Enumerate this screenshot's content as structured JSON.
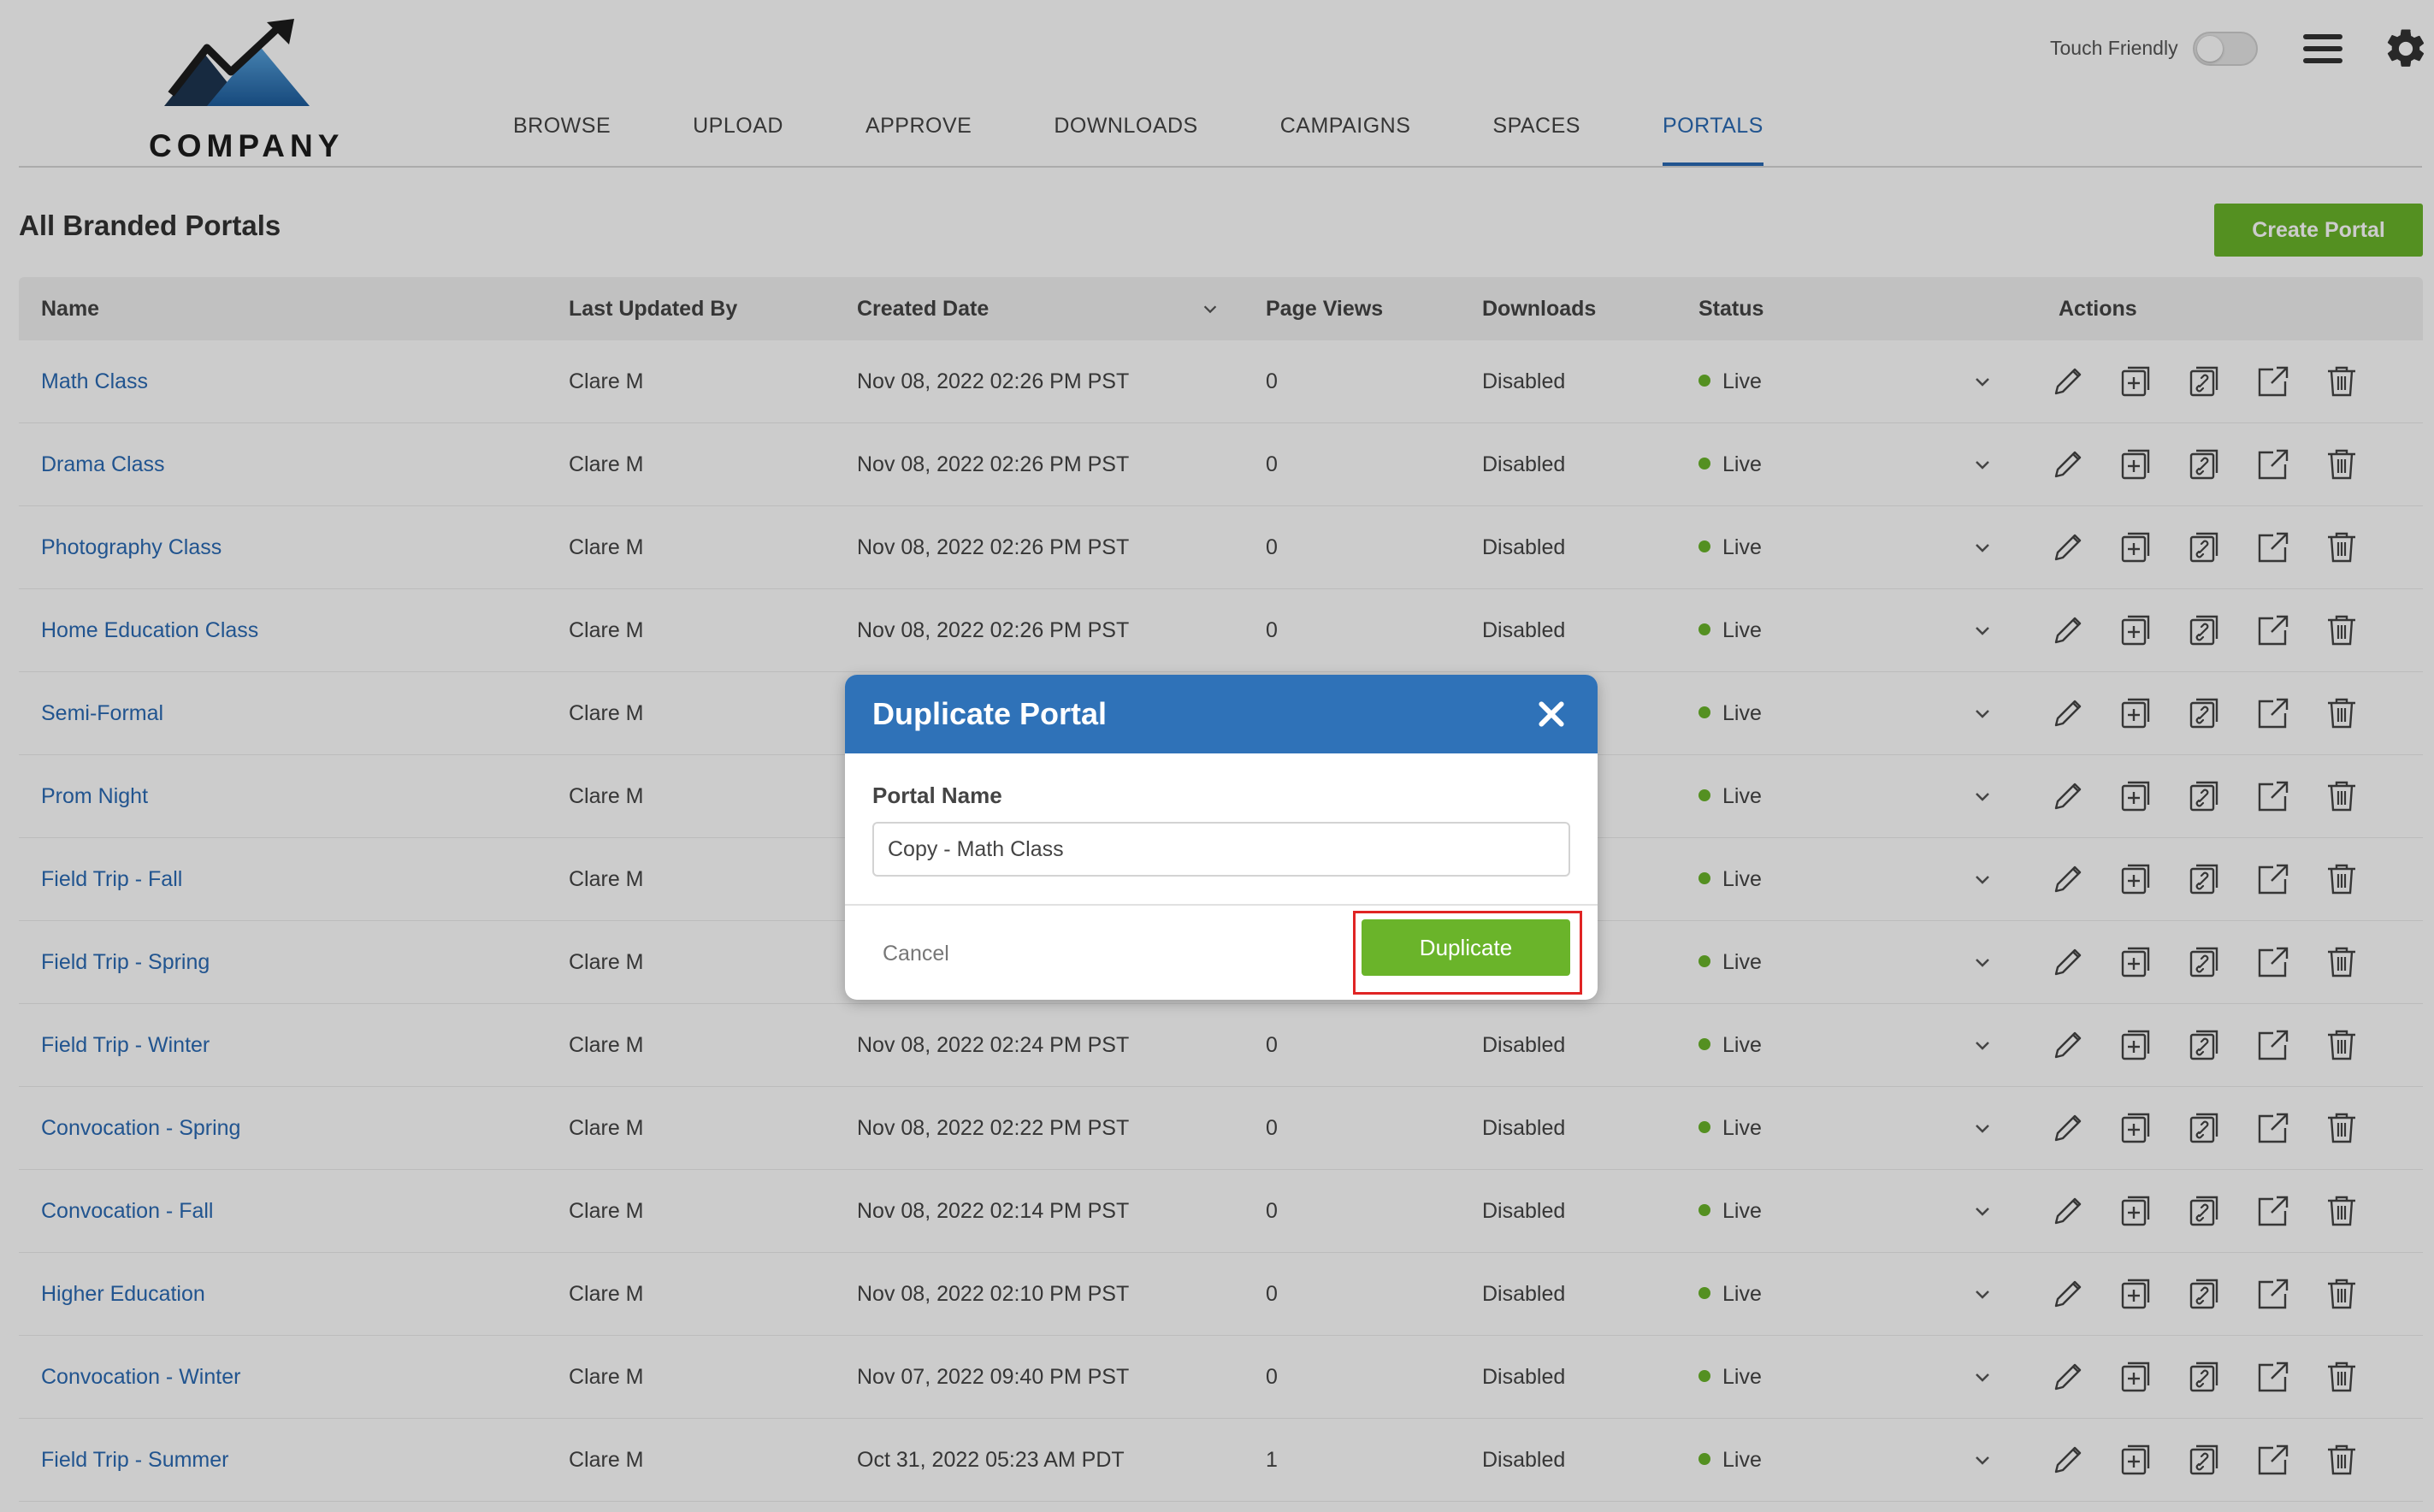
{
  "brand": {
    "logo_text": "COMPANY",
    "accent": "#2a6ab3",
    "green": "#6ab42a"
  },
  "nav": {
    "items": [
      {
        "label": "BROWSE"
      },
      {
        "label": "UPLOAD"
      },
      {
        "label": "APPROVE"
      },
      {
        "label": "DOWNLOADS"
      },
      {
        "label": "CAMPAIGNS"
      },
      {
        "label": "SPACES"
      },
      {
        "label": "PORTALS"
      }
    ],
    "active_index": 6
  },
  "header": {
    "touch_friendly_label": "Touch Friendly",
    "touch_friendly_on": false,
    "menu_icon": "hamburger-icon",
    "settings_icon": "gear-icon"
  },
  "page": {
    "title": "All Branded Portals",
    "create_label": "Create Portal"
  },
  "table": {
    "columns": {
      "name": "Name",
      "updated": "Last Updated By",
      "created": "Created Date",
      "views": "Page Views",
      "downloads": "Downloads",
      "status": "Status",
      "actions": "Actions"
    },
    "action_icons": [
      "pencil-icon",
      "add-page-icon",
      "copy-link-icon",
      "external-link-icon",
      "trash-icon"
    ],
    "rows": [
      {
        "name": "Math Class",
        "updated": "Clare M",
        "created": "Nov 08, 2022 02:26 PM PST",
        "views": "0",
        "downloads": "Disabled",
        "status": "Live"
      },
      {
        "name": "Drama Class",
        "updated": "Clare M",
        "created": "Nov 08, 2022 02:26 PM PST",
        "views": "0",
        "downloads": "Disabled",
        "status": "Live"
      },
      {
        "name": "Photography Class",
        "updated": "Clare M",
        "created": "Nov 08, 2022 02:26 PM PST",
        "views": "0",
        "downloads": "Disabled",
        "status": "Live"
      },
      {
        "name": "Home Education Class",
        "updated": "Clare M",
        "created": "Nov 08, 2022 02:26 PM PST",
        "views": "0",
        "downloads": "Disabled",
        "status": "Live"
      },
      {
        "name": "Semi-Formal",
        "updated": "Clare M",
        "created": "",
        "views": "",
        "downloads": "",
        "status": "Live"
      },
      {
        "name": "Prom Night",
        "updated": "Clare M",
        "created": "",
        "views": "",
        "downloads": "",
        "status": "Live"
      },
      {
        "name": "Field Trip - Fall",
        "updated": "Clare M",
        "created": "",
        "views": "",
        "downloads": "",
        "status": "Live"
      },
      {
        "name": "Field Trip - Spring",
        "updated": "Clare M",
        "created": "",
        "views": "",
        "downloads": "",
        "status": "Live"
      },
      {
        "name": "Field Trip - Winter",
        "updated": "Clare M",
        "created": "Nov 08, 2022 02:24 PM PST",
        "views": "0",
        "downloads": "Disabled",
        "status": "Live"
      },
      {
        "name": "Convocation - Spring",
        "updated": "Clare M",
        "created": "Nov 08, 2022 02:22 PM PST",
        "views": "0",
        "downloads": "Disabled",
        "status": "Live"
      },
      {
        "name": "Convocation - Fall",
        "updated": "Clare M",
        "created": "Nov 08, 2022 02:14 PM PST",
        "views": "0",
        "downloads": "Disabled",
        "status": "Live"
      },
      {
        "name": "Higher Education",
        "updated": "Clare M",
        "created": "Nov 08, 2022 02:10 PM PST",
        "views": "0",
        "downloads": "Disabled",
        "status": "Live"
      },
      {
        "name": "Convocation - Winter",
        "updated": "Clare M",
        "created": "Nov 07, 2022 09:40 PM PST",
        "views": "0",
        "downloads": "Disabled",
        "status": "Live"
      },
      {
        "name": "Field Trip - Summer",
        "updated": "Clare M",
        "created": "Oct 31, 2022 05:23 AM PDT",
        "views": "1",
        "downloads": "Disabled",
        "status": "Live"
      }
    ]
  },
  "modal": {
    "title": "Duplicate Portal",
    "field_label": "Portal Name",
    "field_value": "Copy - Math Class",
    "cancel_label": "Cancel",
    "confirm_label": "Duplicate",
    "header_color": "#2f72b8",
    "highlight_color": "#e02424"
  }
}
